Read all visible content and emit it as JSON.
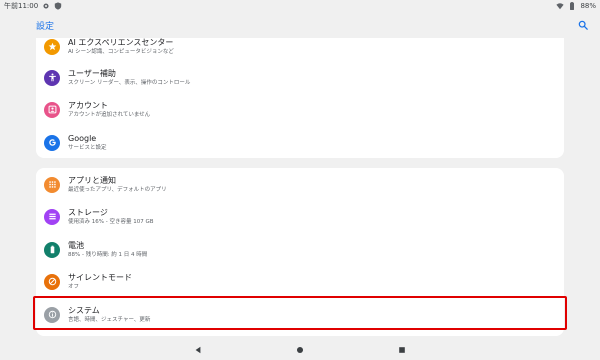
{
  "status_bar": {
    "time": "午前11:00",
    "battery": "88%"
  },
  "app_bar": {
    "title": "設定",
    "search_icon": "search-icon"
  },
  "items": [
    {
      "title": "AI エクスペリエンスセンター",
      "subtitle": "AI シーン認識、コンピュータビジョンなど",
      "icon": "star-icon",
      "color": "#f29900"
    },
    {
      "title": "ユーザー補助",
      "subtitle": "スクリーン リーダー、表示、操作のコントロール",
      "icon": "accessibility-icon",
      "color": "#5e35b1"
    },
    {
      "title": "アカウント",
      "subtitle": "アカウントが追加されていません",
      "icon": "account-icon",
      "color": "#e8538a"
    },
    {
      "title": "Google",
      "subtitle": "サービスと設定",
      "icon": "google-icon",
      "color": "#1a73e8"
    },
    {
      "title": "アプリと通知",
      "subtitle": "最近使ったアプリ、デフォルトのアプリ",
      "icon": "apps-icon",
      "color": "#f28b30"
    },
    {
      "title": "ストレージ",
      "subtitle": "使用済み 16% - 空き容量 107 GB",
      "icon": "storage-icon",
      "color": "#a142f4"
    },
    {
      "title": "電池",
      "subtitle": "88% - 残り時間: 約 1 日 4 時間",
      "icon": "battery-icon",
      "color": "#12806b"
    },
    {
      "title": "サイレントモード",
      "subtitle": "オフ",
      "icon": "do-not-disturb-icon",
      "color": "#e8710a"
    },
    {
      "title": "システム",
      "subtitle": "言語、時間、ジェスチャー、更新",
      "icon": "info-icon",
      "color": "#9aa0a6"
    }
  ],
  "highlight_color": "#e00000"
}
